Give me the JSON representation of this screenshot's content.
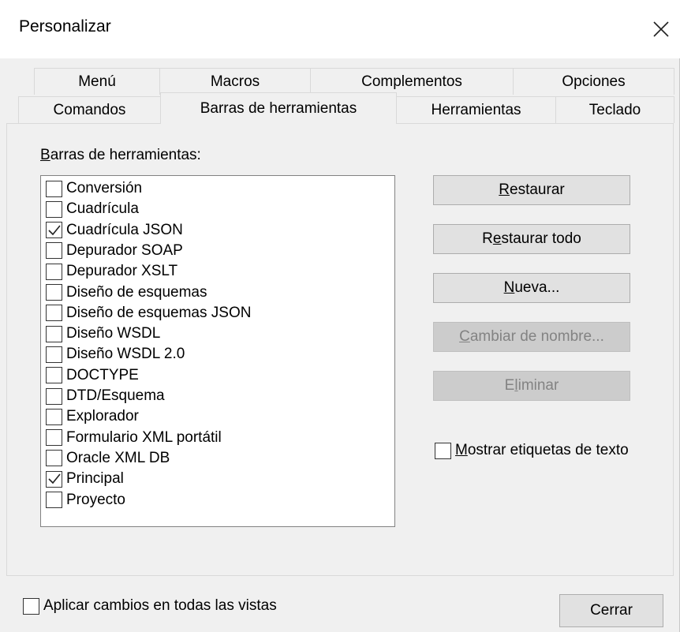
{
  "window": {
    "title": "Personalizar"
  },
  "tabs": {
    "row1": [
      "Menú",
      "Macros",
      "Complementos",
      "Opciones"
    ],
    "row2": [
      "Comandos",
      "Barras de herramientas",
      "Herramientas",
      "Teclado"
    ],
    "active": "Barras de herramientas"
  },
  "toolbars_panel": {
    "label_first": "B",
    "label_rest": "arras de herramientas:",
    "items": [
      {
        "label": "Conversión",
        "checked": false
      },
      {
        "label": "Cuadrícula",
        "checked": false
      },
      {
        "label": "Cuadrícula JSON",
        "checked": true
      },
      {
        "label": "Depurador SOAP",
        "checked": false
      },
      {
        "label": "Depurador XSLT",
        "checked": false
      },
      {
        "label": "Diseño de esquemas",
        "checked": false
      },
      {
        "label": "Diseño de esquemas JSON",
        "checked": false
      },
      {
        "label": "Diseño WSDL",
        "checked": false
      },
      {
        "label": "Diseño WSDL 2.0",
        "checked": false
      },
      {
        "label": "DOCTYPE",
        "checked": false
      },
      {
        "label": "DTD/Esquema",
        "checked": false
      },
      {
        "label": "Explorador",
        "checked": false
      },
      {
        "label": "Formulario XML portátil",
        "checked": false
      },
      {
        "label": "Oracle XML DB",
        "checked": false
      },
      {
        "label": "Principal",
        "checked": true
      },
      {
        "label": "Proyecto",
        "checked": false
      }
    ]
  },
  "buttons": {
    "restaurar": {
      "u": "R",
      "rest": "estaurar"
    },
    "restaurar_todo": {
      "pre": "R",
      "u": "e",
      "rest": "staurar todo"
    },
    "nueva": {
      "u": "N",
      "rest": "ueva..."
    },
    "cambiar_nombre": {
      "u": "C",
      "rest": "ambiar de nombre..."
    },
    "eliminar": {
      "pre": "E",
      "u": "l",
      "rest": "iminar"
    }
  },
  "show_text_labels": {
    "u": "M",
    "rest": "ostrar etiquetas de texto",
    "checked": false
  },
  "apply_all_views": {
    "label": "Aplicar cambios en todas las vistas",
    "checked": false
  },
  "close_button": {
    "label": "Cerrar"
  },
  "colors": {
    "accent": "#000000",
    "disabled_text": "#838383"
  }
}
